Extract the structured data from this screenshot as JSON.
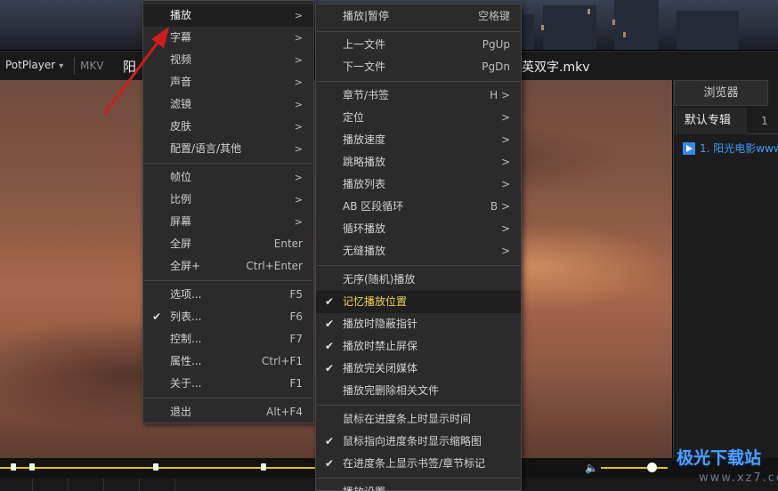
{
  "player": {
    "app_button": "PotPlayer",
    "format": "MKV",
    "title_left": "阳",
    "title_right": "英双字.mkv"
  },
  "right_panel": {
    "browser_tab": "浏览器",
    "tabs": [
      "默认专辑",
      "1"
    ],
    "playlist_item": "1. 阳光电影www"
  },
  "main_menu": {
    "items": [
      {
        "label": "播放",
        "arrow": ">"
      },
      {
        "label": "字幕",
        "arrow": ">"
      },
      {
        "label": "视频",
        "arrow": ">"
      },
      {
        "label": "声音",
        "arrow": ">"
      },
      {
        "label": "滤镜",
        "arrow": ">"
      },
      {
        "label": "皮肤",
        "arrow": ">"
      },
      {
        "label": "配置/语言/其他",
        "arrow": ">"
      },
      {
        "label": "帧位",
        "arrow": ">"
      },
      {
        "label": "比例",
        "arrow": ">"
      },
      {
        "label": "屏幕",
        "arrow": ">"
      },
      {
        "label": "全屏",
        "shortcut": "Enter"
      },
      {
        "label": "全屏+",
        "shortcut": "Ctrl+Enter"
      },
      {
        "label": "选项...",
        "shortcut": "F5"
      },
      {
        "label": "列表...",
        "shortcut": "F6",
        "checked": true
      },
      {
        "label": "控制...",
        "shortcut": "F7"
      },
      {
        "label": "属性...",
        "shortcut": "Ctrl+F1"
      },
      {
        "label": "关于...",
        "shortcut": "F1"
      },
      {
        "label": "退出",
        "shortcut": "Alt+F4"
      }
    ]
  },
  "play_submenu": {
    "items": [
      {
        "label": "播放|暂停",
        "shortcut": "空格键"
      },
      {
        "label": "上一文件",
        "shortcut": "PgUp"
      },
      {
        "label": "下一文件",
        "shortcut": "PgDn"
      },
      {
        "label": "章节/书签",
        "shortcut": "H >"
      },
      {
        "label": "定位",
        "shortcut": ">"
      },
      {
        "label": "播放速度",
        "shortcut": ">"
      },
      {
        "label": "跳略播放",
        "shortcut": ">"
      },
      {
        "label": "播放列表",
        "shortcut": ">"
      },
      {
        "label": "AB 区段循环",
        "shortcut": "B >"
      },
      {
        "label": "循环播放",
        "shortcut": ">"
      },
      {
        "label": "无缝播放",
        "shortcut": ">"
      },
      {
        "label": "无序(随机)播放"
      },
      {
        "label": "记忆播放位置",
        "checked": true
      },
      {
        "label": "播放时隐蔽指针",
        "checked": true
      },
      {
        "label": "播放时禁止屏保",
        "checked": true
      },
      {
        "label": "播放完关闭媒体",
        "checked": true
      },
      {
        "label": "播放完删除相关文件"
      },
      {
        "label": "鼠标在进度条上时显示时间"
      },
      {
        "label": "鼠标指向进度条时显示缩略图",
        "checked": true
      },
      {
        "label": "在进度条上显示书签/章节标记",
        "checked": true
      },
      {
        "label": "播放设置"
      }
    ]
  },
  "watermark": {
    "text": "极光下载站",
    "url": "www.xz7.com"
  },
  "colors": {
    "menu_bg": "#2b2b2b",
    "highlight_text": "#f2d24c",
    "seek_accent": "#e6c200",
    "playlist_link": "#3e9bff",
    "annotation_arrow": "#d21c1c"
  }
}
